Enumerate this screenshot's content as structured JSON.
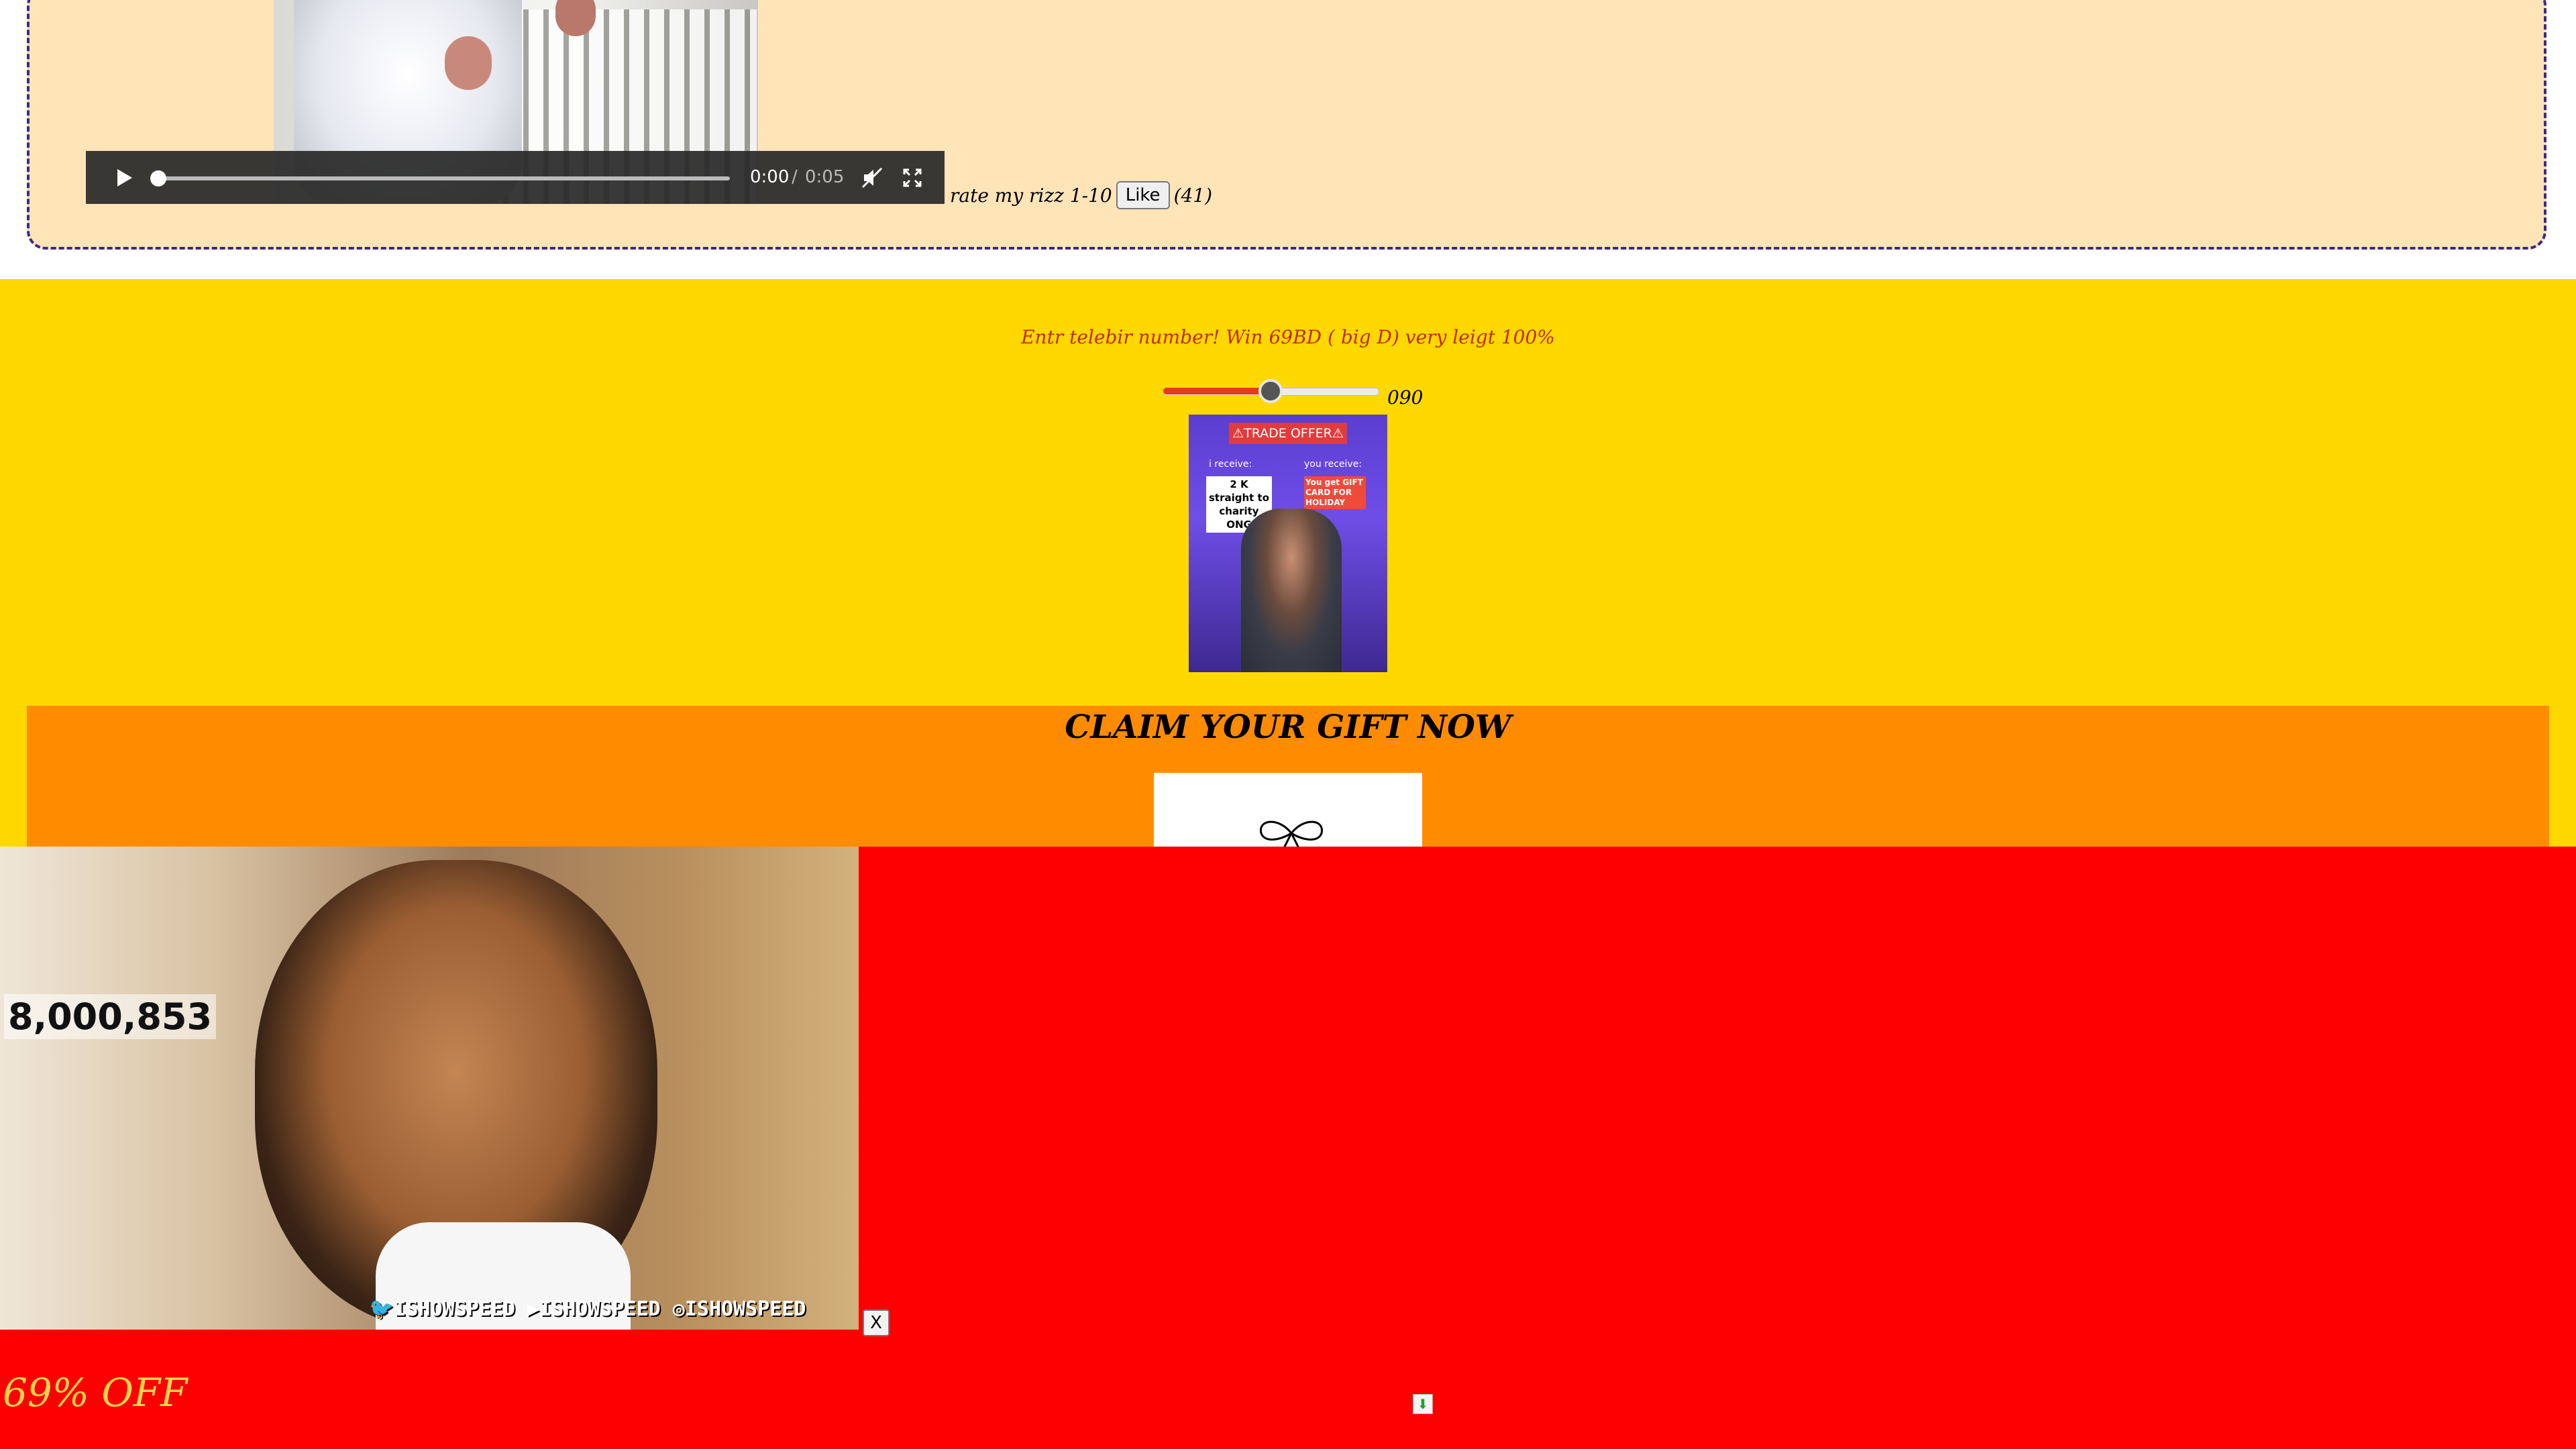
{
  "post": {
    "video": {
      "current_time": "0:00",
      "separator": "/",
      "duration": "0:05",
      "progress_fraction": 0.0,
      "muted": true
    },
    "rate_text": "rate my rizz 1-10",
    "like_label": "Like",
    "like_count": "(41)"
  },
  "promo": {
    "text": "Entr telebir number! Win 69BD ( big D) very leigt 100%",
    "slider": {
      "value": "090",
      "fraction": 0.5,
      "min": 0,
      "max": 100
    },
    "trade_offer": {
      "title": "⚠TRADE OFFER⚠",
      "i_receive_label": "i receive:",
      "you_receive_label": "you receive:",
      "i_receive_text": "2 K straight to charity ONG",
      "you_receive_text": "You get GIFT CARD FOR HOLIDAY"
    }
  },
  "claim": {
    "title": "CLAIM YOUR GIFT NOW",
    "gift_icon": "gift-icon"
  },
  "overlay": {
    "counter": "8,000,853",
    "social_handles": [
      "ISHOWSPEED",
      "ISHOWSPEED",
      "ISHOWSPEED"
    ],
    "close_label": "X",
    "discount_text": "69% OFF"
  },
  "colors": {
    "post_bg": "#ffe4b8",
    "post_border": "#3a2a88",
    "yellow_bg": "#ffd800",
    "promo_text": "#c22a00",
    "claim_bg": "#ff8c00",
    "overlay_bg": "#ff0000",
    "discount_text": "#ffd54a"
  }
}
